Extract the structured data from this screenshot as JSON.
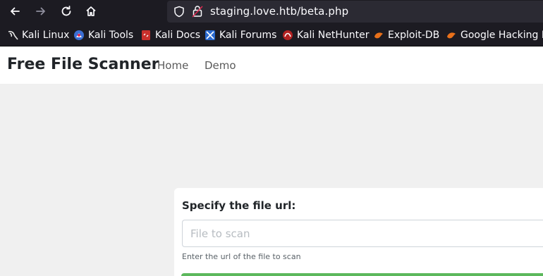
{
  "browser": {
    "url": "staging.love.htb/beta.php",
    "nav_icons": [
      "back-arrow-icon",
      "forward-arrow-icon",
      "reload-icon",
      "home-icon"
    ],
    "urlbar_icons": [
      "shield-icon",
      "lock-icon"
    ],
    "bookmarks": [
      {
        "label": "Kali Linux",
        "icon": "kali-dragon-icon"
      },
      {
        "label": "Kali Tools",
        "icon": "kali-tools-icon"
      },
      {
        "label": "Kali Docs",
        "icon": "kali-docs-icon"
      },
      {
        "label": "Kali Forums",
        "icon": "kali-forums-icon"
      },
      {
        "label": "Kali NetHunter",
        "icon": "nethunter-icon"
      },
      {
        "label": "Exploit-DB",
        "icon": "exploit-db-icon"
      },
      {
        "label": "Google Hacking DB",
        "icon": "ghdb-icon"
      }
    ]
  },
  "navbar": {
    "brand": "Free File Scanner",
    "links": [
      "Home",
      "Demo"
    ]
  },
  "form": {
    "label": "Specify the file url:",
    "input_placeholder": "File to scan",
    "input_value": "",
    "help": "Enter the url of the file to scan"
  },
  "colors": {
    "chrome_bg": "#1c1b22",
    "urlbar_bg": "#2b2a33",
    "page_bg": "#f0f0f0",
    "submit_green": "#5cb85c"
  }
}
